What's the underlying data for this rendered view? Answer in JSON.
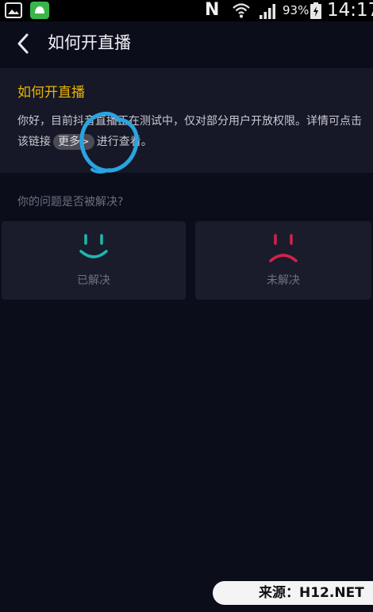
{
  "status_bar": {
    "battery_percent": "93%",
    "time": "14:17",
    "notification_letter": "N"
  },
  "header": {
    "title": "如何开直播"
  },
  "article": {
    "title": "如何开直播",
    "body_before_link": "你好，目前抖音直播正在测试中，仅对部分用户开放权限。详情可点击该链接",
    "link_label": "更多>",
    "body_after_link": "进行查看。"
  },
  "feedback": {
    "question": "你的问题是否被解决?",
    "solved_label": "已解决",
    "unsolved_label": "未解决",
    "solved_color": "#1fb7b0",
    "unsolved_color": "#d6204a"
  },
  "watermark": {
    "text": "来源：H12.NET"
  },
  "colors": {
    "background": "#0c0d1a",
    "card": "#161827",
    "accent_title": "#e9b400",
    "annotation": "#2aa4e0"
  }
}
